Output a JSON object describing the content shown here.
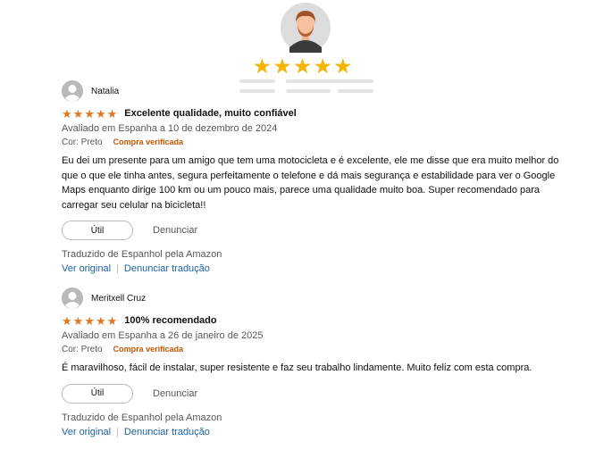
{
  "hero": {
    "rating": 5
  },
  "reviews": [
    {
      "name": "Natalia",
      "stars": 5,
      "title": "Excelente qualidade, muito confiável",
      "meta": "Avaliado em Espanha a 10 de dezembro de 2024",
      "variant": "Cor: Preto",
      "verified": "Compra verificada",
      "body": "Eu dei um presente para um amigo que tem uma motocicleta e é excelente, ele me disse que era muito melhor do que o que ele tinha antes, segura perfeitamente o telefone e dá mais segurança e estabilidade para ver o Google Maps enquanto dirige 100 km ou um pouco mais, parece uma qualidade muito boa. Super recomendado para carregar seu celular na bicicleta!!",
      "helpful": "Útil",
      "report": "Denunciar",
      "translated": "Traduzido de Espanhol pela Amazon",
      "see_original": "Ver original",
      "report_translation": "Denunciar tradução"
    },
    {
      "name": "Meritxell Cruz",
      "stars": 5,
      "title": "100% recomendado",
      "meta": "Avaliado em Espanha a 26 de janeiro de 2025",
      "variant": "Cor: Preto",
      "verified": "Compra verificada",
      "body": "É maravilhoso, fácil de instalar, super resistente e faz seu trabalho lindamente. Muito feliz com esta compra.",
      "helpful": "Útil",
      "report": "Denunciar",
      "translated": "Traduzido de Espanhol pela Amazon",
      "see_original": "Ver original",
      "report_translation": "Denunciar tradução"
    }
  ],
  "colors": {
    "star": "#de7921",
    "hero_star": "#f5b500",
    "link": "#2162a1",
    "verified": "#c45500"
  }
}
